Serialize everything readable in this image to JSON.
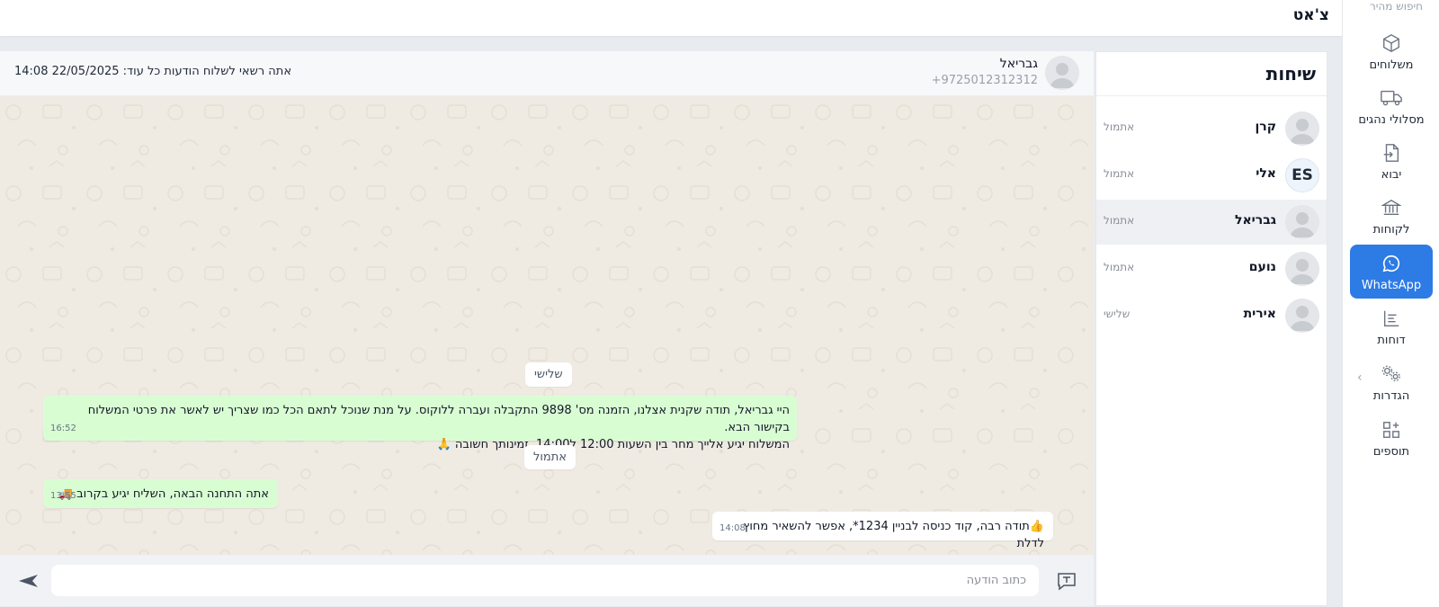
{
  "header": {
    "title": "צ'אט"
  },
  "rail": {
    "search_label": "חיפוש מהיר",
    "items": [
      {
        "label": "משלוחים",
        "icon": "box-icon"
      },
      {
        "label": "מסלולי נהגים",
        "icon": "truck-icon"
      },
      {
        "label": "יבוא",
        "icon": "file-import-icon"
      },
      {
        "label": "לקוחות",
        "icon": "bank-icon"
      },
      {
        "label": "WhatsApp",
        "icon": "whatsapp-icon"
      },
      {
        "label": "דוחות",
        "icon": "report-icon"
      },
      {
        "label": "הגדרות",
        "icon": "gears-icon"
      },
      {
        "label": "תוספים",
        "icon": "addons-icon"
      }
    ]
  },
  "conversations": {
    "title": "שיחות",
    "items": [
      {
        "name": "קרן",
        "time": "אתמול",
        "avatar": "placeholder"
      },
      {
        "name": "אלי",
        "time": "אתמול",
        "avatar": "ES"
      },
      {
        "name": "גבריאל",
        "time": "אתמול",
        "avatar": "placeholder"
      },
      {
        "name": "נועם",
        "time": "אתמול",
        "avatar": "placeholder"
      },
      {
        "name": "אירית",
        "time": "שלישי",
        "avatar": "placeholder"
      }
    ]
  },
  "chat": {
    "contact_name": "גבריאל",
    "contact_phone": "+9725012312312",
    "notice": "אתה רשאי לשלוח הודעות כל עוד: 22/05/2025 14:08",
    "messages": [
      {
        "type": "date",
        "text": "שלישי"
      },
      {
        "type": "out",
        "line1": "היי גבריאל, תודה שקנית אצלנו, הזמנה מס' 9898 התקבלה ועברה ללוקוס. על מנת שנוכל לתאם הכל כמו שצריך יש לאשר את פרטי המשלוח בקישור הבא.",
        "line2": "המשלוח יגיע אלייך מחר בין השעות 12:00 ל14:00, זמינותך חשובה 🙏",
        "time": "16:52"
      },
      {
        "type": "date",
        "text": "אתמול"
      },
      {
        "type": "out",
        "line1": "אתה התחנה הבאה, השליח יגיע בקרוב 🚚",
        "time": "13:55"
      },
      {
        "type": "in",
        "line1": "👍תודה רבה, קוד כניסה לבניין 1234*, אפשר להשאיר מחוץ לדלת",
        "time": "14:08"
      }
    ]
  },
  "composer": {
    "placeholder": "כתוב הודעה"
  },
  "colors": {
    "accent": "#2d7be5",
    "outgoing_bubble": "#d9fdd3",
    "chat_bg": "#efeae2"
  }
}
